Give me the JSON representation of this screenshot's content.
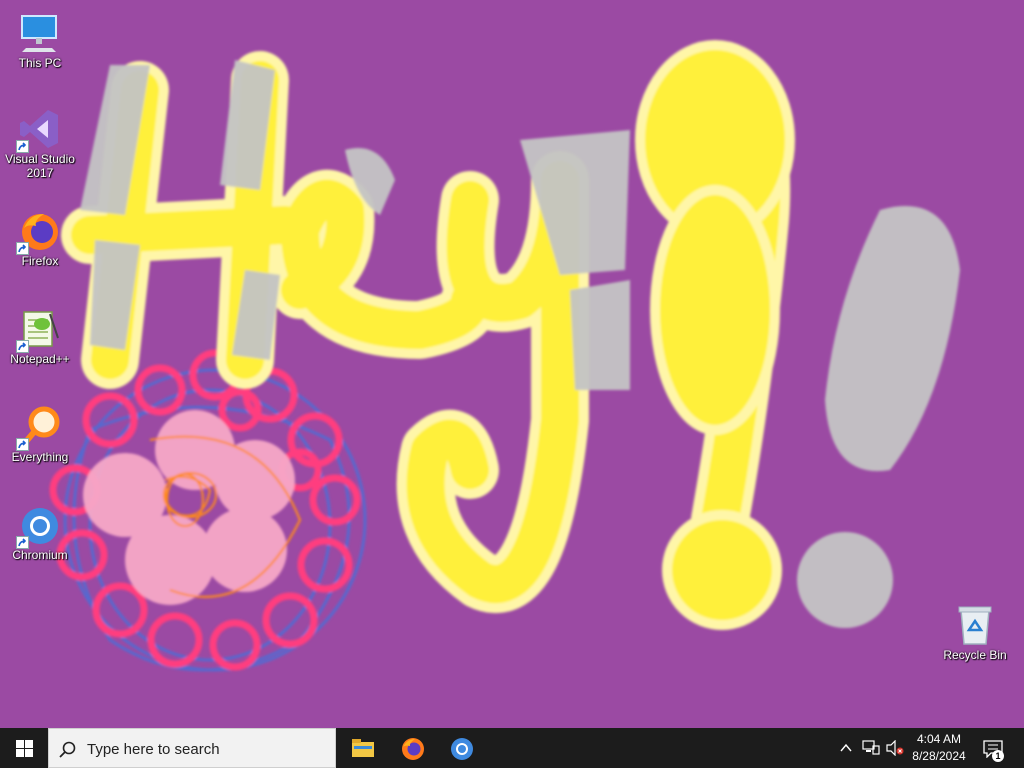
{
  "desktop": {
    "background_color": "#9b4aa3",
    "wallpaper_text": "Hey!!",
    "icons": [
      {
        "label": "This PC",
        "icon": "computer-icon"
      },
      {
        "label": "Visual Studio 2017",
        "icon": "visual-studio-icon"
      },
      {
        "label": "Firefox",
        "icon": "firefox-icon"
      },
      {
        "label": "Notepad++",
        "icon": "notepadpp-icon"
      },
      {
        "label": "Everything",
        "icon": "everything-search-icon"
      },
      {
        "label": "Chromium",
        "icon": "chromium-icon"
      },
      {
        "label": "Recycle Bin",
        "icon": "recycle-bin-icon"
      }
    ]
  },
  "taskbar": {
    "search": {
      "placeholder": "Type here to search"
    },
    "pinned": [
      {
        "name": "File Explorer",
        "icon": "folder-icon"
      },
      {
        "name": "Firefox",
        "icon": "firefox-icon"
      },
      {
        "name": "Chromium",
        "icon": "chromium-icon"
      }
    ],
    "tray": {
      "time": "4:04 AM",
      "date": "8/28/2024",
      "notification_count": "1"
    }
  }
}
